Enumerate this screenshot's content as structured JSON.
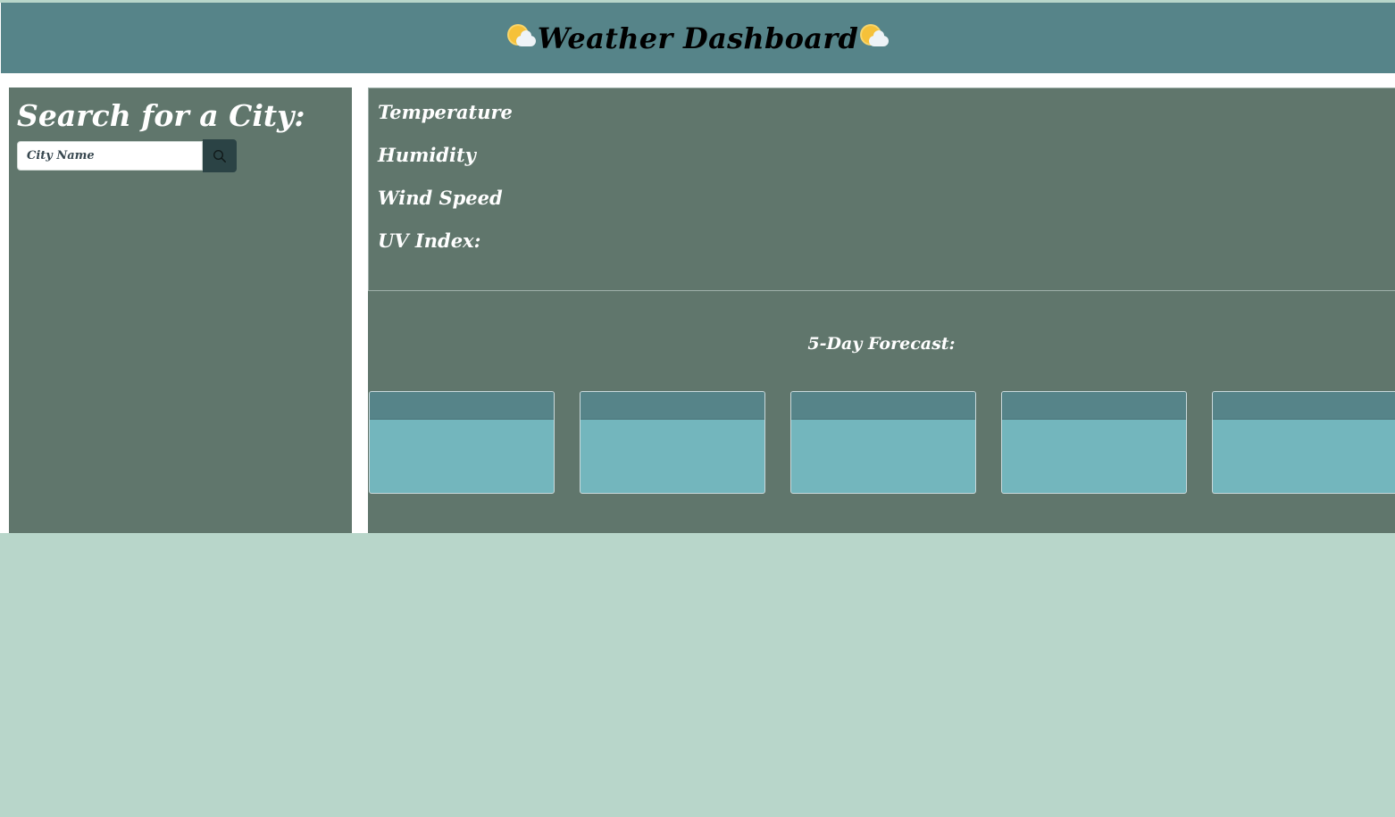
{
  "header": {
    "title": "Weather Dashboard",
    "icon": "sun-behind-cloud-icon"
  },
  "sidebar": {
    "title": "Search for a City:",
    "search": {
      "placeholder": "City Name",
      "value": "",
      "button_icon": "search-icon"
    }
  },
  "current": {
    "temperature_label": "Temperature",
    "humidity_label": "Humidity",
    "wind_label": "Wind Speed",
    "uv_label": "UV Index:"
  },
  "forecast": {
    "title": "5-Day Forecast:",
    "cards": [
      {
        "date": ""
      },
      {
        "date": ""
      },
      {
        "date": ""
      },
      {
        "date": ""
      },
      {
        "date": ""
      }
    ]
  },
  "colors": {
    "page_background": "#b8d6ca",
    "header_background": "#568489",
    "panel_background": "#60766c",
    "card_body": "#73b6bd",
    "search_button": "#2b4345"
  }
}
